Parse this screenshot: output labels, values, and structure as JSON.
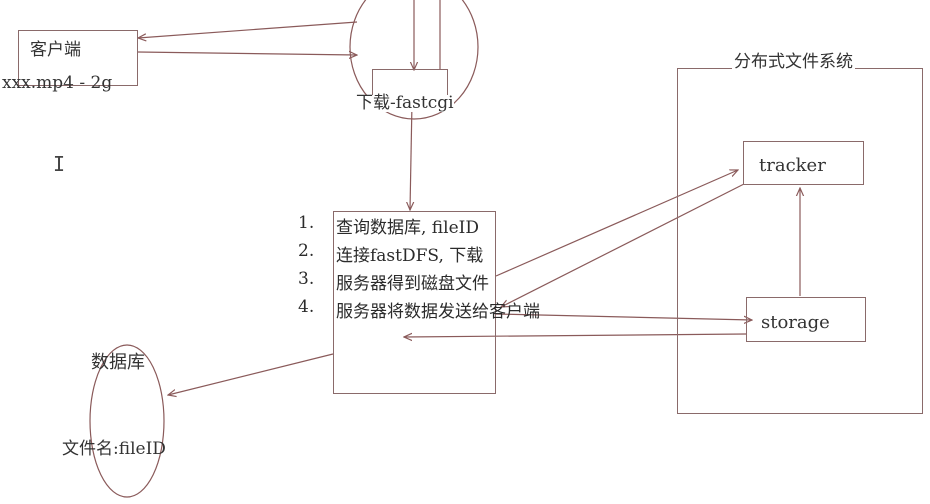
{
  "client": {
    "title": "客户端",
    "file": "xxx.mp4 - 2g"
  },
  "download": {
    "label": "下载-fastcgi"
  },
  "steps": [
    {
      "num": "1.",
      "text": "查询数据库, fileID"
    },
    {
      "num": "2.",
      "text": "连接fastDFS, 下载"
    },
    {
      "num": "3.",
      "text": "服务器得到磁盘文件"
    },
    {
      "num": "4.",
      "text": "服务器将数据发送给客户端"
    }
  ],
  "database": {
    "title": "数据库",
    "field": "文件名:fileID"
  },
  "dfs": {
    "title": "分布式文件系统",
    "tracker": "tracker",
    "storage": "storage"
  }
}
